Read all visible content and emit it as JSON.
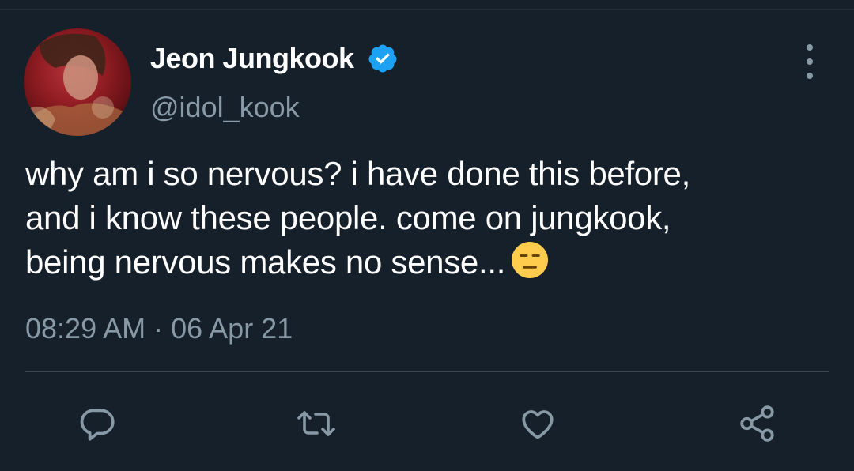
{
  "tweet": {
    "display_name": "Jeon Jungkook",
    "handle": "@idol_kook",
    "text_lines": [
      "why am i so nervous? i have done this before,",
      "and i know these people. come on jungkook,",
      "being nervous makes no sense..."
    ],
    "emoji": "expressionless-face",
    "timestamp": "08:29 AM · 06 Apr 21",
    "verified": true
  },
  "icons": {
    "verified": "verified-badge-icon",
    "more": "more-vertical-icon",
    "reply": "reply-icon",
    "retweet": "retweet-icon",
    "like": "heart-icon",
    "share": "share-icon"
  },
  "colors": {
    "background": "#15202b",
    "text": "#ffffff",
    "secondary_text": "#8899a6",
    "divider": "#38444d",
    "verified_blue": "#1da1f2",
    "emoji_yellow": "#ffcc4d"
  }
}
